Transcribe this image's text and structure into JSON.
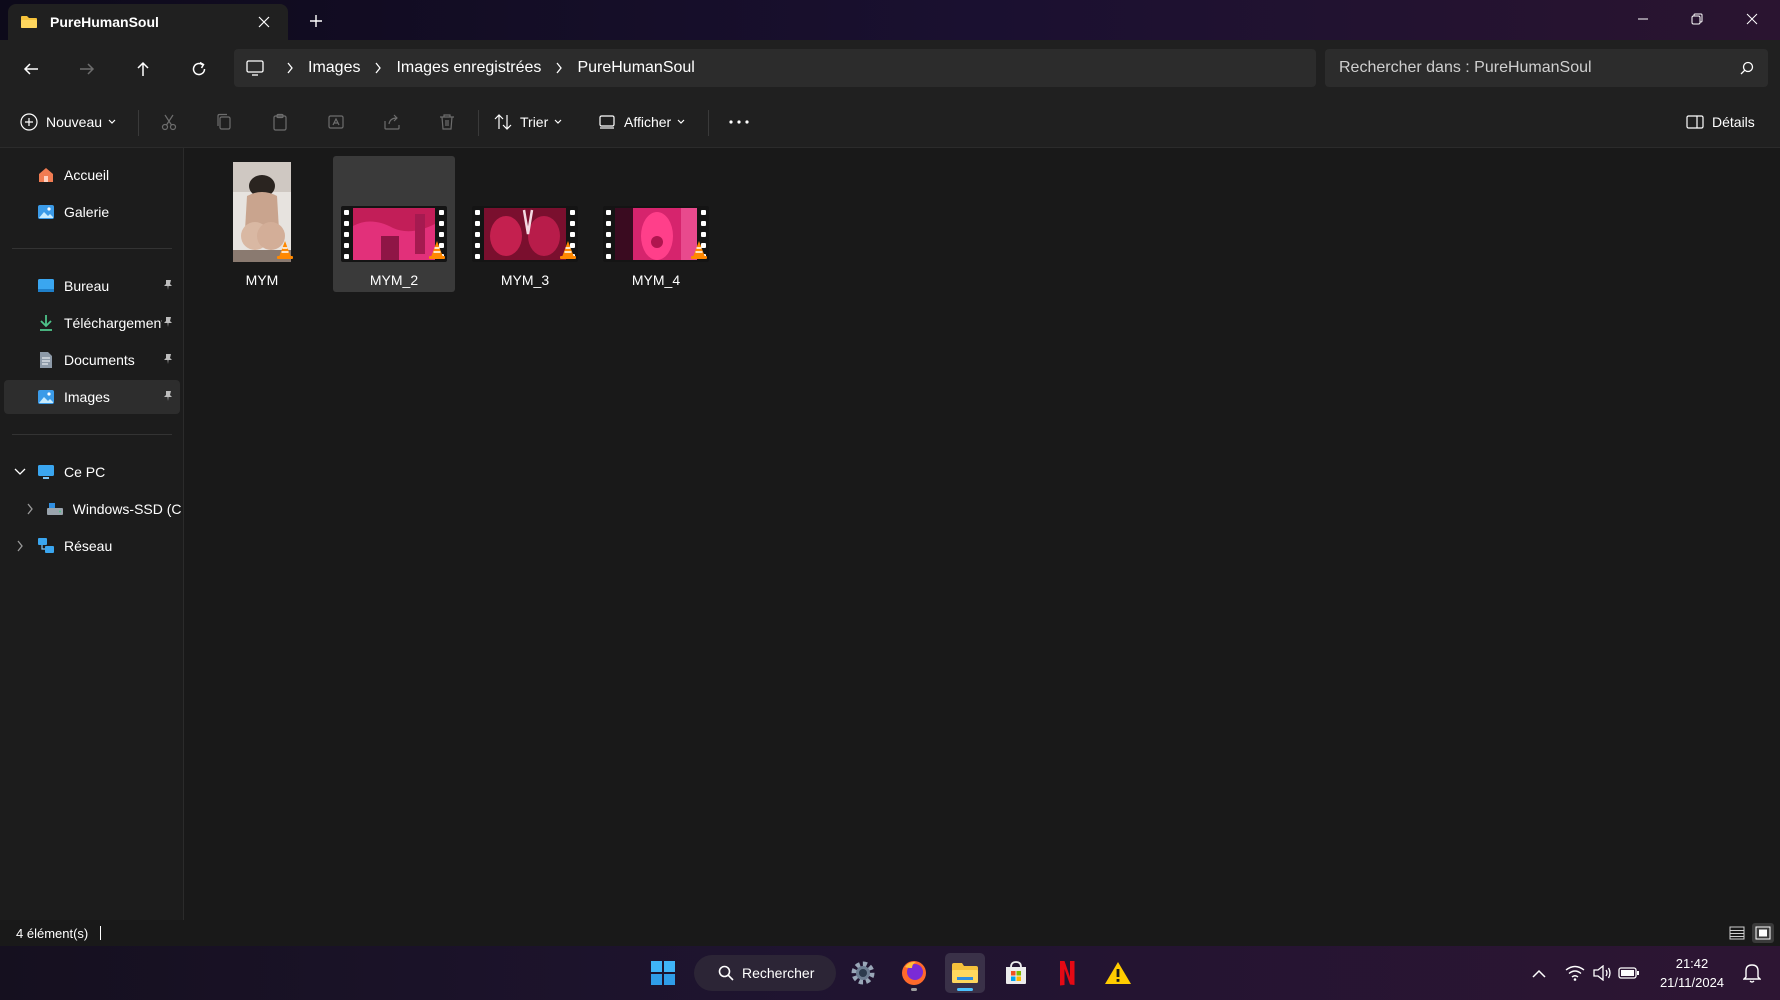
{
  "window": {
    "tab_title": "PureHumanSoul",
    "icons": {
      "tab": "folder-icon",
      "close": "close-icon",
      "new_tab": "plus-icon"
    }
  },
  "address_bar": {
    "breadcrumbs": [
      "Images",
      "Images enregistrées",
      "PureHumanSoul"
    ],
    "search_placeholder": "Rechercher dans : PureHumanSoul"
  },
  "command_bar": {
    "new_label": "Nouveau",
    "sort_label": "Trier",
    "view_label": "Afficher",
    "details_label": "Détails"
  },
  "sidebar": {
    "quick": [
      {
        "label": "Accueil",
        "icon": "home-icon"
      },
      {
        "label": "Galerie",
        "icon": "gallery-icon"
      }
    ],
    "pinned": [
      {
        "label": "Bureau",
        "icon": "desktop-icon"
      },
      {
        "label": "Téléchargements",
        "icon": "download-icon"
      },
      {
        "label": "Documents",
        "icon": "document-icon"
      },
      {
        "label": "Images",
        "icon": "pictures-icon",
        "selected": true
      }
    ],
    "tree": [
      {
        "label": "Ce PC",
        "icon": "computer-icon",
        "expanded": true
      },
      {
        "label": "Windows-SSD (C:)",
        "icon": "drive-icon"
      },
      {
        "label": "Réseau",
        "icon": "network-icon"
      }
    ]
  },
  "files": [
    {
      "name": "MYM",
      "type": "video",
      "thumbnail": "portrait"
    },
    {
      "name": "MYM_2",
      "type": "video",
      "thumbnail": "film",
      "selected": true
    },
    {
      "name": "MYM_3",
      "type": "video",
      "thumbnail": "film"
    },
    {
      "name": "MYM_4",
      "type": "video",
      "thumbnail": "film"
    }
  ],
  "status_bar": {
    "item_count": "4 élément(s)"
  },
  "taskbar": {
    "search_label": "Rechercher",
    "apps": [
      "windows-start-icon",
      "search-icon",
      "settings-icon",
      "firefox-icon",
      "file-explorer-icon",
      "microsoft-store-icon",
      "netflix-icon",
      "warning-icon"
    ],
    "active_app": "file-explorer-icon"
  },
  "clock": {
    "time": "21:42",
    "date": "21/11/2024"
  },
  "colors": {
    "accent": "#4cc2ff",
    "folder": "#f5c23b",
    "vlc_orange": "#ff8800",
    "thumb_magenta": "#d9246b",
    "background": "#191919"
  }
}
